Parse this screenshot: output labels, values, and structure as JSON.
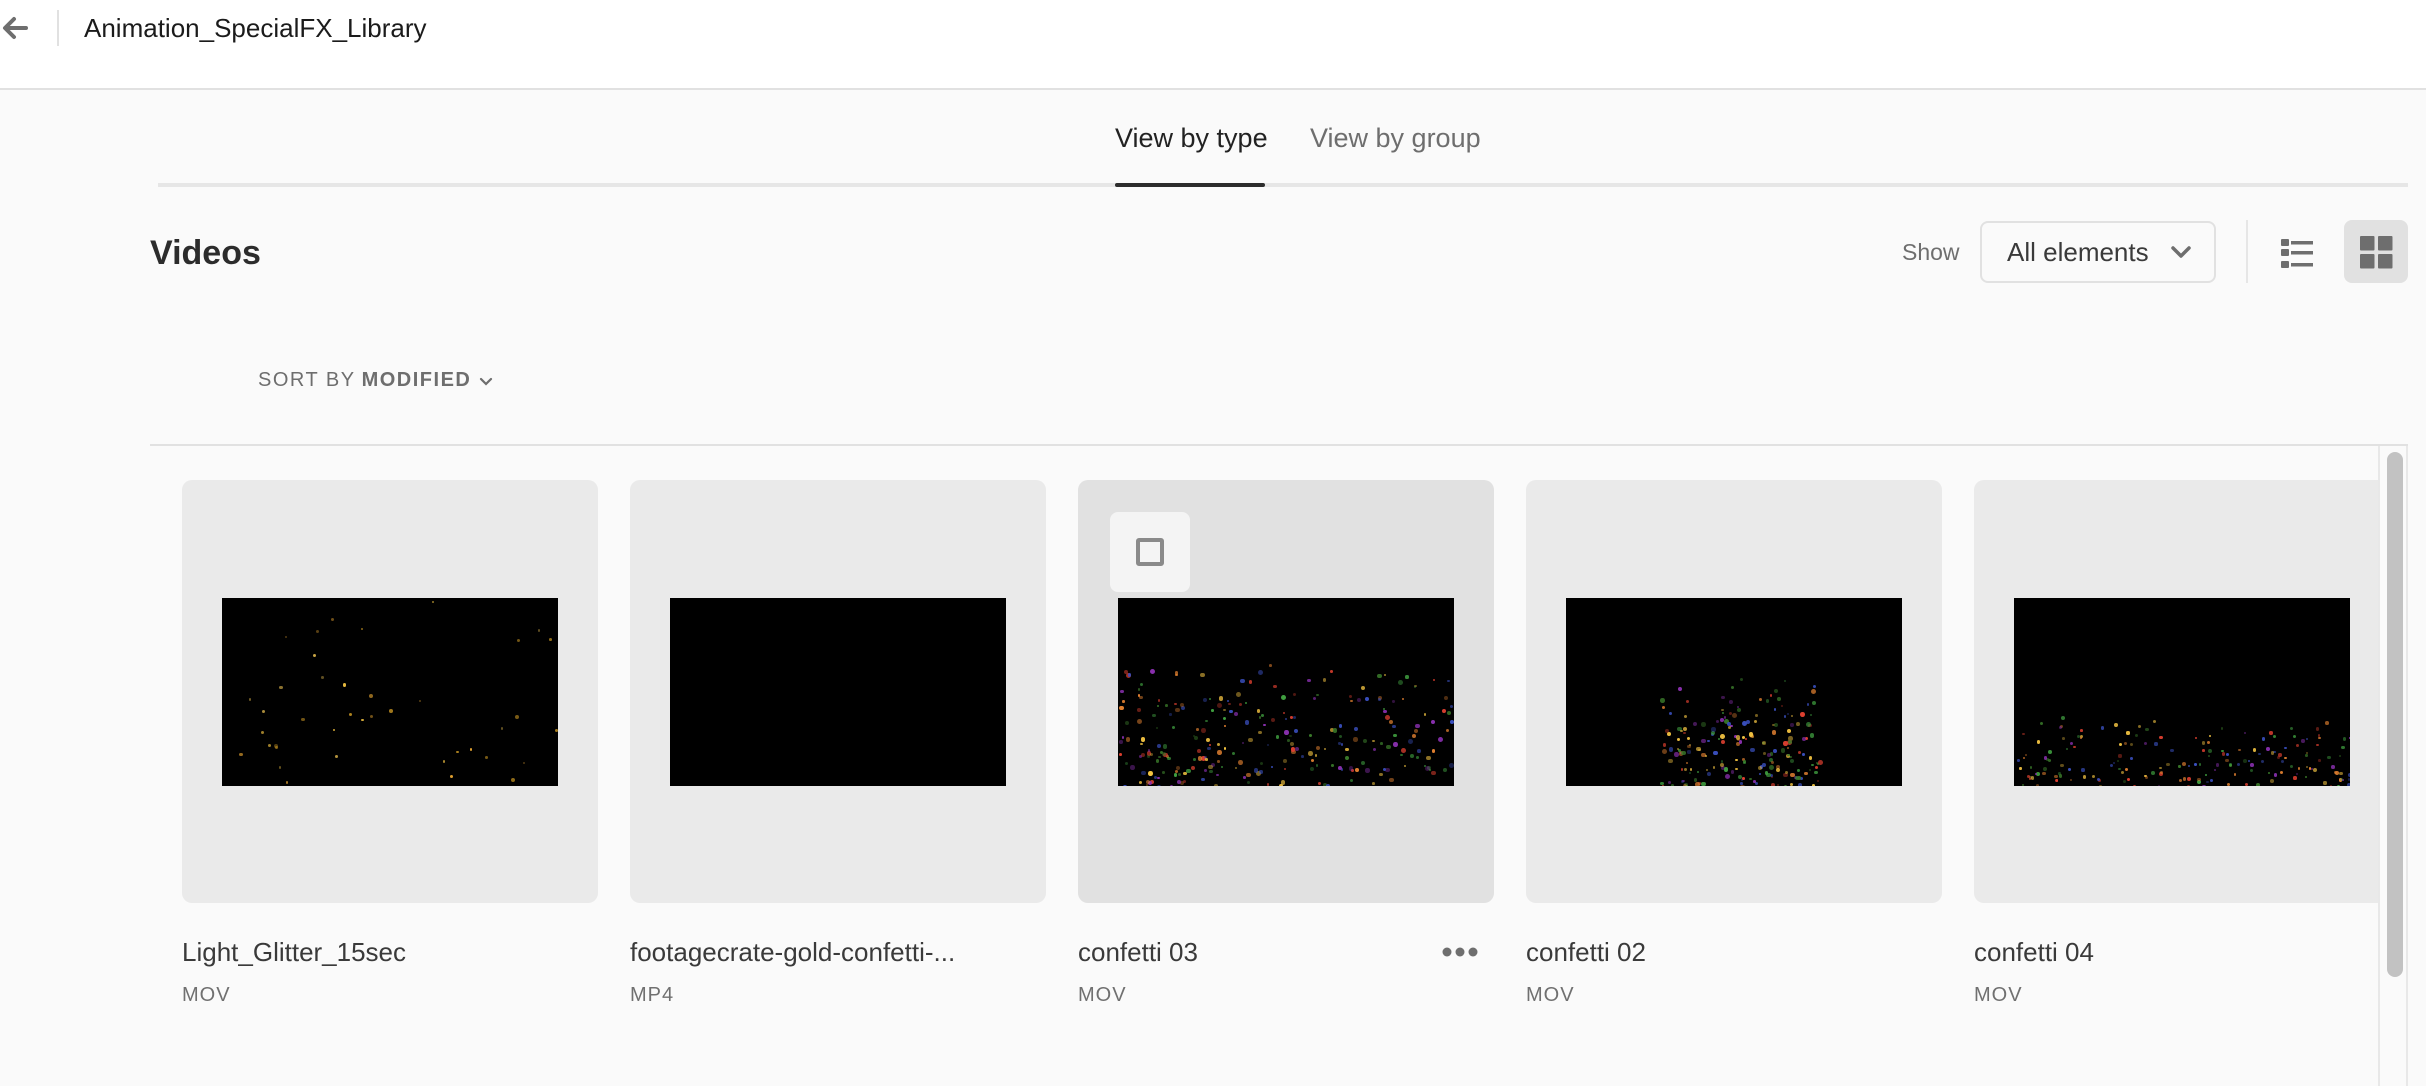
{
  "header": {
    "back_icon": "arrow-left-icon",
    "title": "Animation_SpecialFX_Library"
  },
  "tabs": [
    {
      "label": "View by type",
      "active": true
    },
    {
      "label": "View by group",
      "active": false
    }
  ],
  "section": {
    "title": "Videos",
    "show_label": "Show",
    "filter_value": "All elements",
    "view_modes": [
      {
        "name": "list",
        "icon": "list-view-icon",
        "active": false
      },
      {
        "name": "grid",
        "icon": "grid-view-icon",
        "active": true
      }
    ],
    "sort_label": "SORT BY",
    "sort_value": "MODIFIED"
  },
  "items": [
    {
      "name": "Light_Glitter_15sec",
      "type": "MOV",
      "thumbnail": "sparse-gold-glitter"
    },
    {
      "name": "footagecrate-gold-confetti-...",
      "type": "MP4",
      "thumbnail": "black"
    },
    {
      "name": "confetti 03",
      "type": "MOV",
      "thumbnail": "multicolor-confetti-bottom",
      "hovered": true
    },
    {
      "name": "confetti 02",
      "type": "MOV",
      "thumbnail": "multicolor-confetti-burst"
    },
    {
      "name": "confetti 04",
      "type": "MOV",
      "thumbnail": "multicolor-confetti-low"
    }
  ],
  "colors": {
    "background": "#fafafa",
    "card": "#eaeaea",
    "card_hover": "#e1e1e1",
    "active_tab": "#2c2c2c",
    "muted_text": "#6e6e6e"
  }
}
